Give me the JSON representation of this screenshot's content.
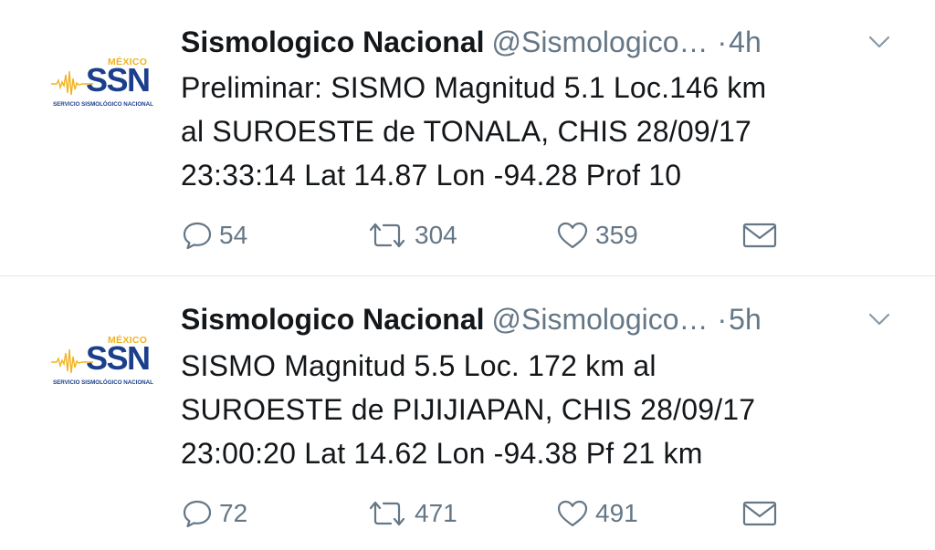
{
  "tweets": [
    {
      "account": {
        "display_name": "Sismologico Nacional",
        "handle": "@Sismologico…",
        "avatar": {
          "top_text": "MÉXICO",
          "main_text": "SSN",
          "sub_text": "SERVICIO SISMOLÓGICO NACIONAL"
        }
      },
      "separator": "·",
      "time": "4h",
      "text_lines": [
        "Preliminar: SISMO Magnitud 5.1 Loc.146 km",
        "al SUROESTE de TONALA, CHIS 28/09/17",
        "23:33:14 Lat 14.87 Lon -94.28 Prof 10"
      ],
      "actions": {
        "replies": "54",
        "retweets": "304",
        "likes": "359"
      }
    },
    {
      "account": {
        "display_name": "Sismologico Nacional",
        "handle": "@Sismologico…",
        "avatar": {
          "top_text": "MÉXICO",
          "main_text": "SSN",
          "sub_text": "SERVICIO SISMOLÓGICO NACIONAL"
        }
      },
      "separator": "·",
      "time": "5h",
      "text_lines": [
        "SISMO Magnitud 5.5 Loc. 172 km al",
        "SUROESTE de PIJIJIAPAN, CHIS 28/09/17",
        "23:00:20 Lat 14.62 Lon -94.38 Pf 21 km"
      ],
      "actions": {
        "replies": "72",
        "retweets": "471",
        "likes": "491"
      }
    }
  ],
  "icons": {
    "reply": "speech-bubble-icon",
    "retweet": "retweet-arrows-icon",
    "like": "heart-icon",
    "dm": "envelope-icon",
    "menu": "chevron-down-icon"
  },
  "colors": {
    "text": "#14171a",
    "secondary": "#657786",
    "divider": "#e1e8ed",
    "ssn_blue": "#1b3f8c",
    "ssn_gold": "#f2b320"
  }
}
